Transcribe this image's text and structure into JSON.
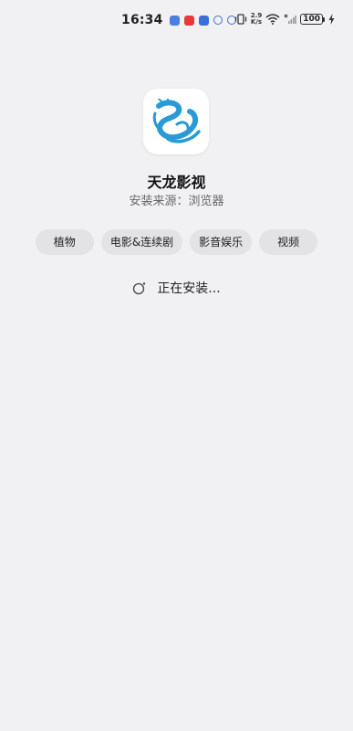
{
  "status_bar": {
    "time": "16:34",
    "net_speed_value": "2.9",
    "net_speed_unit": "K/s",
    "battery": "100",
    "icons": [
      "notif-app-icon",
      "notif-red-icon",
      "notif-blue-icon",
      "notif-gear-icon",
      "notif-gear-icon",
      "vibrate-icon",
      "wifi-icon",
      "signal-icon",
      "charging-icon"
    ]
  },
  "app": {
    "name": "天龙影视",
    "install_source": "安装来源：浏览器",
    "icon": "dragon-logo-icon",
    "icon_color": "#2a9ad6"
  },
  "tags": [
    {
      "label": "植物"
    },
    {
      "label": "电影&连续剧"
    },
    {
      "label": "影音娱乐"
    },
    {
      "label": "视频"
    }
  ],
  "install_status": {
    "text": "正在安装..."
  }
}
